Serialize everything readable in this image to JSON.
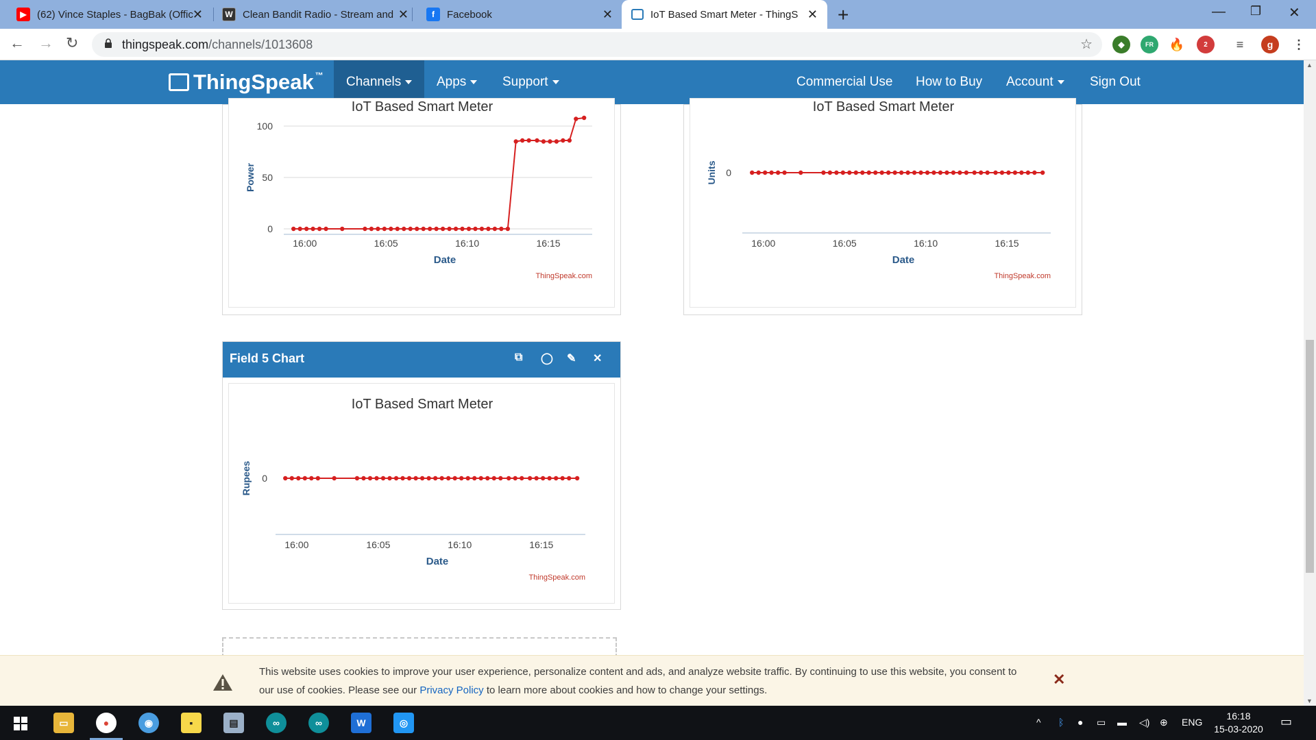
{
  "browser": {
    "tabs": [
      {
        "title": "(62) Vince Staples - BagBak (Offic",
        "icon": "youtube-icon"
      },
      {
        "title": "Clean Bandit Radio - Stream and",
        "icon": "radio-icon"
      },
      {
        "title": "Facebook",
        "icon": "facebook-icon"
      },
      {
        "title": "IoT Based Smart Meter - ThingSp",
        "icon": "thingspeak-icon"
      }
    ],
    "url_host": "thingspeak.com",
    "url_path": "/channels/1013608",
    "profile_initial": "g",
    "ext_badge": "2",
    "ext_fr": "FR"
  },
  "nav": {
    "logo": "ThingSpeak",
    "logo_tm": "™",
    "channels": "Channels",
    "apps": "Apps",
    "support": "Support",
    "commercial": "Commercial Use",
    "how_to_buy": "How to Buy",
    "account": "Account",
    "sign_out": "Sign Out"
  },
  "panels": {
    "field5_title": "Field 5 Chart"
  },
  "chart_data": [
    {
      "type": "line",
      "title": "IoT Based Smart Meter",
      "xlabel": "Date",
      "ylabel": "Power",
      "credit": "ThingSpeak.com",
      "x_ticks": [
        "16:00",
        "16:05",
        "16:10",
        "16:15"
      ],
      "ylim": [
        0,
        100
      ],
      "y_ticks": [
        0,
        50,
        100
      ],
      "series": [
        {
          "color": "#d62020",
          "x": [
            15.6,
            16.0,
            16.4,
            16.8,
            17.2,
            17.6,
            18.6,
            20.0,
            20.4,
            20.8,
            21.2,
            21.6,
            22.0,
            22.4,
            22.8,
            23.2,
            23.6,
            24.0,
            24.4,
            24.8,
            25.2,
            25.6,
            26.0,
            26.4,
            26.8,
            27.2,
            27.6,
            28.0,
            28.4,
            28.8,
            29.3,
            29.7,
            30.1,
            30.6,
            31.0,
            31.4,
            31.8,
            32.2,
            32.6,
            33.0,
            33.5
          ],
          "y": [
            0,
            0,
            0,
            0,
            0,
            0,
            0,
            0,
            0,
            0,
            0,
            0,
            0,
            0,
            0,
            0,
            0,
            0,
            0,
            0,
            0,
            0,
            0,
            0,
            0,
            0,
            0,
            0,
            0,
            0,
            85,
            86,
            86,
            86,
            85,
            85,
            85,
            86,
            86,
            107,
            108
          ]
        }
      ]
    },
    {
      "type": "line",
      "title": "IoT Based Smart Meter",
      "xlabel": "Date",
      "ylabel": "Units",
      "credit": "ThingSpeak.com",
      "x_ticks": [
        "16:00",
        "16:05",
        "16:10",
        "16:15"
      ],
      "y_ticks": [
        0
      ],
      "series": [
        {
          "color": "#d62020",
          "x": [
            15.6,
            16.0,
            16.4,
            16.8,
            17.2,
            17.6,
            18.6,
            20.0,
            20.4,
            20.8,
            21.2,
            21.6,
            22.0,
            22.4,
            22.8,
            23.2,
            23.6,
            24.0,
            24.4,
            24.8,
            25.2,
            25.6,
            26.0,
            26.4,
            26.8,
            27.2,
            27.6,
            28.0,
            28.4,
            28.8,
            29.3,
            29.7,
            30.1,
            30.6,
            31.0,
            31.4,
            31.8,
            32.2,
            32.6,
            33.0,
            33.5
          ],
          "y": [
            0,
            0,
            0,
            0,
            0,
            0,
            0,
            0,
            0,
            0,
            0,
            0,
            0,
            0,
            0,
            0,
            0,
            0,
            0,
            0,
            0,
            0,
            0,
            0,
            0,
            0,
            0,
            0,
            0,
            0,
            0,
            0,
            0,
            0,
            0,
            0,
            0,
            0,
            0,
            0,
            0
          ]
        }
      ]
    },
    {
      "type": "line",
      "title": "IoT Based Smart Meter",
      "xlabel": "Date",
      "ylabel": "Rupees",
      "credit": "ThingSpeak.com",
      "x_ticks": [
        "16:00",
        "16:05",
        "16:10",
        "16:15"
      ],
      "y_ticks": [
        0
      ],
      "series": [
        {
          "color": "#d62020",
          "x": [
            15.6,
            16.0,
            16.4,
            16.8,
            17.2,
            17.6,
            18.6,
            20.0,
            20.4,
            20.8,
            21.2,
            21.6,
            22.0,
            22.4,
            22.8,
            23.2,
            23.6,
            24.0,
            24.4,
            24.8,
            25.2,
            25.6,
            26.0,
            26.4,
            26.8,
            27.2,
            27.6,
            28.0,
            28.4,
            28.8,
            29.3,
            29.7,
            30.1,
            30.6,
            31.0,
            31.4,
            31.8,
            32.2,
            32.6,
            33.0,
            33.5
          ],
          "y": [
            0,
            0,
            0,
            0,
            0,
            0,
            0,
            0,
            0,
            0,
            0,
            0,
            0,
            0,
            0,
            0,
            0,
            0,
            0,
            0,
            0,
            0,
            0,
            0,
            0,
            0,
            0,
            0,
            0,
            0,
            0,
            0,
            0,
            0,
            0,
            0,
            0,
            0,
            0,
            0,
            0
          ]
        }
      ]
    }
  ],
  "cookie": {
    "text_before": "This website uses cookies to improve your user experience, personalize content and ads, and analyze website traffic. By continuing to use this website, you consent to our use of cookies. Please see our ",
    "link": "Privacy Policy",
    "text_after": " to learn more about cookies and how to change your settings."
  },
  "taskbar": {
    "lang": "ENG",
    "time": "16:18",
    "date": "15-03-2020"
  },
  "colors": {
    "nav_blue": "#2a7ab8",
    "series_red": "#d62020",
    "axis_label_blue": "#2b5a8a"
  }
}
